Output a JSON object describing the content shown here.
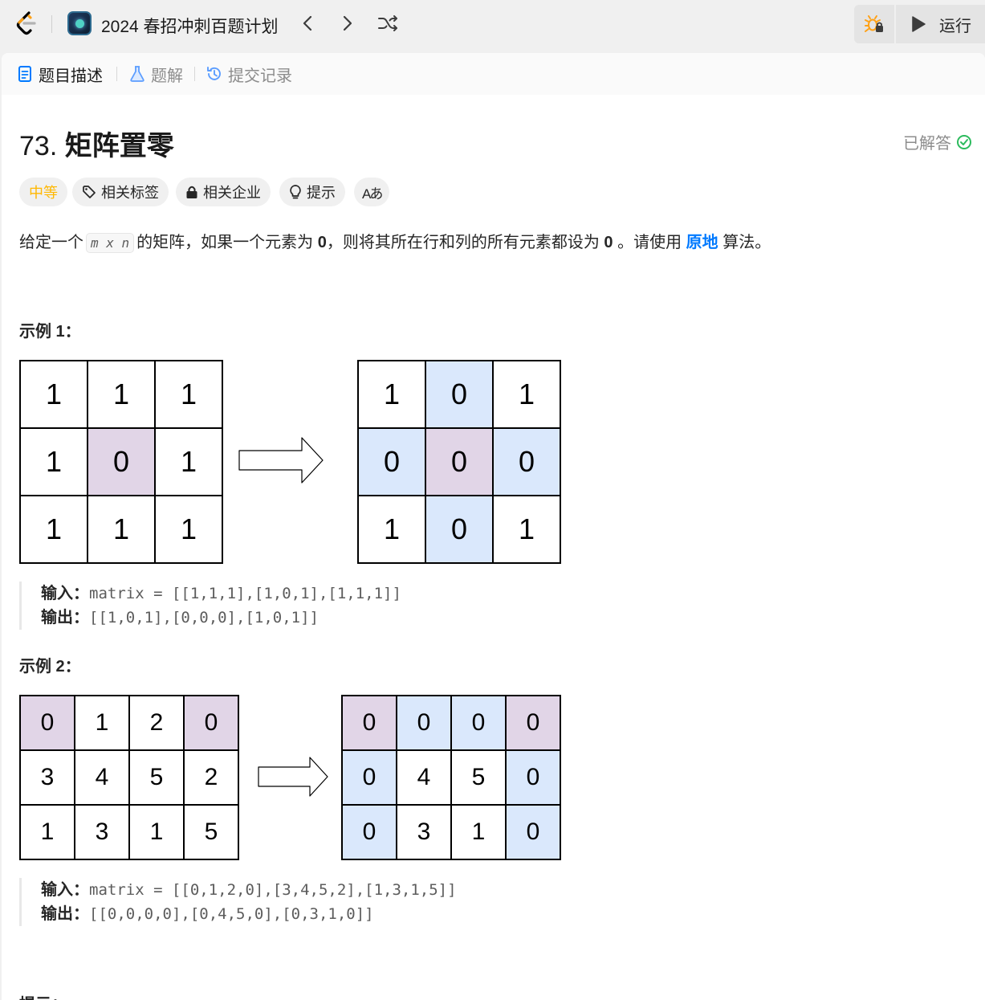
{
  "header": {
    "plan_title": "2024 春招冲刺百题计划",
    "run_label": "运行"
  },
  "tabs": [
    {
      "label": "题目描述"
    },
    {
      "label": "题解"
    },
    {
      "label": "提交记录"
    }
  ],
  "problem": {
    "number": "73.",
    "name": "矩阵置零",
    "solved_label": "已解答",
    "tags": {
      "difficulty": "中等",
      "related_tags": "相关标签",
      "related_companies": "相关企业",
      "hint": "提示",
      "font": "Aあ"
    },
    "desc": {
      "p1": "给定一个",
      "code": "m x n",
      "p2": "的矩阵，如果一个元素为",
      "zero1": "0",
      "p3": "，则将其所在行和列的所有元素都设为",
      "zero2": "0",
      "p4": "。请使用",
      "link": "原地",
      "p5": "算法。"
    }
  },
  "example1": {
    "title": "示例 1：",
    "input_grid": [
      [
        "1",
        "1",
        "1"
      ],
      [
        "1",
        "0",
        "1"
      ],
      [
        "1",
        "1",
        "1"
      ]
    ],
    "output_grid": [
      [
        "1",
        "0",
        "1"
      ],
      [
        "0",
        "0",
        "0"
      ],
      [
        "1",
        "0",
        "1"
      ]
    ],
    "input_label": "输入：",
    "input_value": "matrix = [[1,1,1],[1,0,1],[1,1,1]]",
    "output_label": "输出：",
    "output_value": "[[1,0,1],[0,0,0],[1,0,1]]"
  },
  "example2": {
    "title": "示例 2：",
    "input_grid": [
      [
        "0",
        "1",
        "2",
        "0"
      ],
      [
        "3",
        "4",
        "5",
        "2"
      ],
      [
        "1",
        "3",
        "1",
        "5"
      ]
    ],
    "output_grid": [
      [
        "0",
        "0",
        "0",
        "0"
      ],
      [
        "0",
        "4",
        "5",
        "0"
      ],
      [
        "0",
        "3",
        "1",
        "0"
      ]
    ],
    "input_label": "输入：",
    "input_value": "matrix = [[0,1,2,0],[3,4,5,2],[1,3,1,5]]",
    "output_label": "输出：",
    "output_value": "[[0,0,0,0],[0,4,5,0],[0,3,1,0]]"
  },
  "constraints_title": "提示："
}
